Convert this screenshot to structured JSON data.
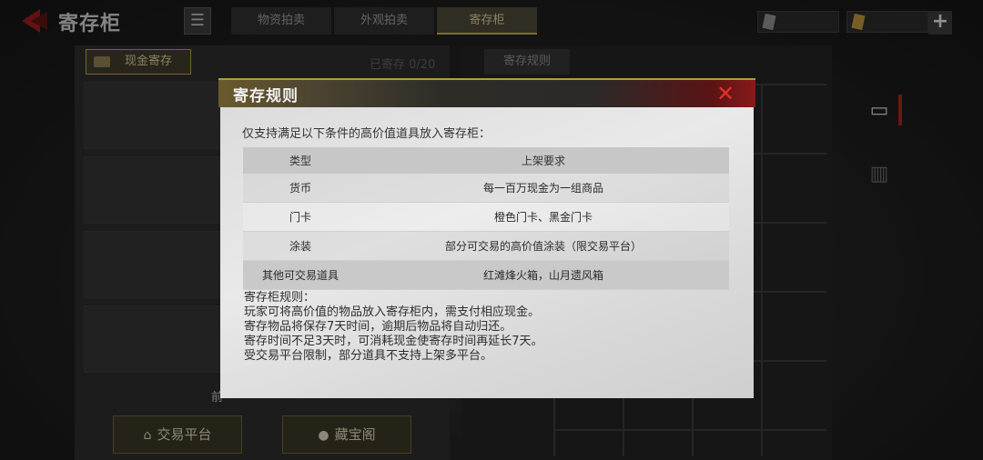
{
  "header": {
    "title": "寄存柜",
    "tabs": [
      {
        "label": "物资拍卖",
        "active": false
      },
      {
        "label": "外观拍卖",
        "active": false
      },
      {
        "label": "寄存柜",
        "active": true
      }
    ],
    "icons": {
      "back": "back-arrow-icon",
      "menu": "menu-icon",
      "add": "plus-icon"
    }
  },
  "left_panel": {
    "cash_button": "现金寄存",
    "stored_label": "已寄存",
    "stored_count": "0/20",
    "hint_partial": "前",
    "bottom_buttons": [
      {
        "label": "交易平台",
        "icon": "house-icon"
      },
      {
        "label": "藏宝阁",
        "icon": "treasure-icon"
      }
    ]
  },
  "right_panel": {
    "tab": "寄存规则"
  },
  "modal": {
    "title": "寄存规则",
    "intro": "仅支持满足以下条件的高价值道具放入寄存柜：",
    "table": {
      "headers": [
        "类型",
        "上架要求"
      ],
      "rows": [
        [
          "货币",
          "每一百万现金为一组商品"
        ],
        [
          "门卡",
          "橙色门卡、黑金门卡"
        ],
        [
          "涂装",
          "部分可交易的高价值涂装（限交易平台）"
        ],
        [
          "其他可交易道具",
          "红滩烽火箱，山月遗风箱"
        ]
      ]
    },
    "notes": [
      "寄存柜规则：",
      "玩家可将高价值的物品放入寄存柜内，需支付相应现金。",
      "寄存物品将保存7天时间，逾期后物品将自动归还。",
      "寄存时间不足3天时，可消耗现金使寄存时间再延长7天。",
      "受交易平台限制，部分道具不支持上架多平台。"
    ]
  },
  "colors": {
    "accent_gold": "#c7a94a",
    "close_red": "#e23030",
    "alert_red": "#b02020"
  }
}
